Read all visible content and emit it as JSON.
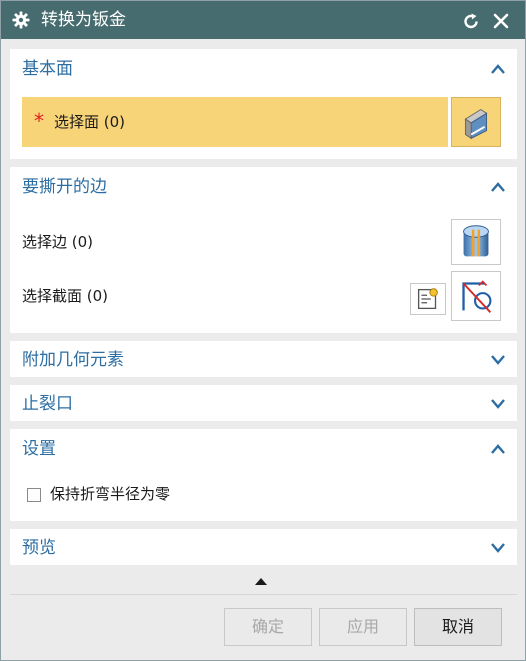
{
  "title": "转换为钣金",
  "sections": {
    "base_face": {
      "title": "基本面",
      "select_face_label": "选择面 (0)",
      "required_marker": "*"
    },
    "edges_to_rip": {
      "title": "要撕开的边",
      "select_edge_label": "选择边 (0)",
      "select_section_label": "选择截面 (0)"
    },
    "additional_geometry": {
      "title": "附加几何元素"
    },
    "relief": {
      "title": "止裂口"
    },
    "settings": {
      "title": "设置",
      "keep_zero_radius_label": "保持折弯半径为零",
      "keep_zero_radius_checked": false
    },
    "preview": {
      "title": "预览"
    }
  },
  "buttons": {
    "ok": "确定",
    "apply": "应用",
    "cancel": "取消"
  },
  "colors": {
    "titlebar": "#476c6f",
    "section_title": "#2c6ea3",
    "highlight": "#f8d479",
    "required": "#e02020"
  }
}
